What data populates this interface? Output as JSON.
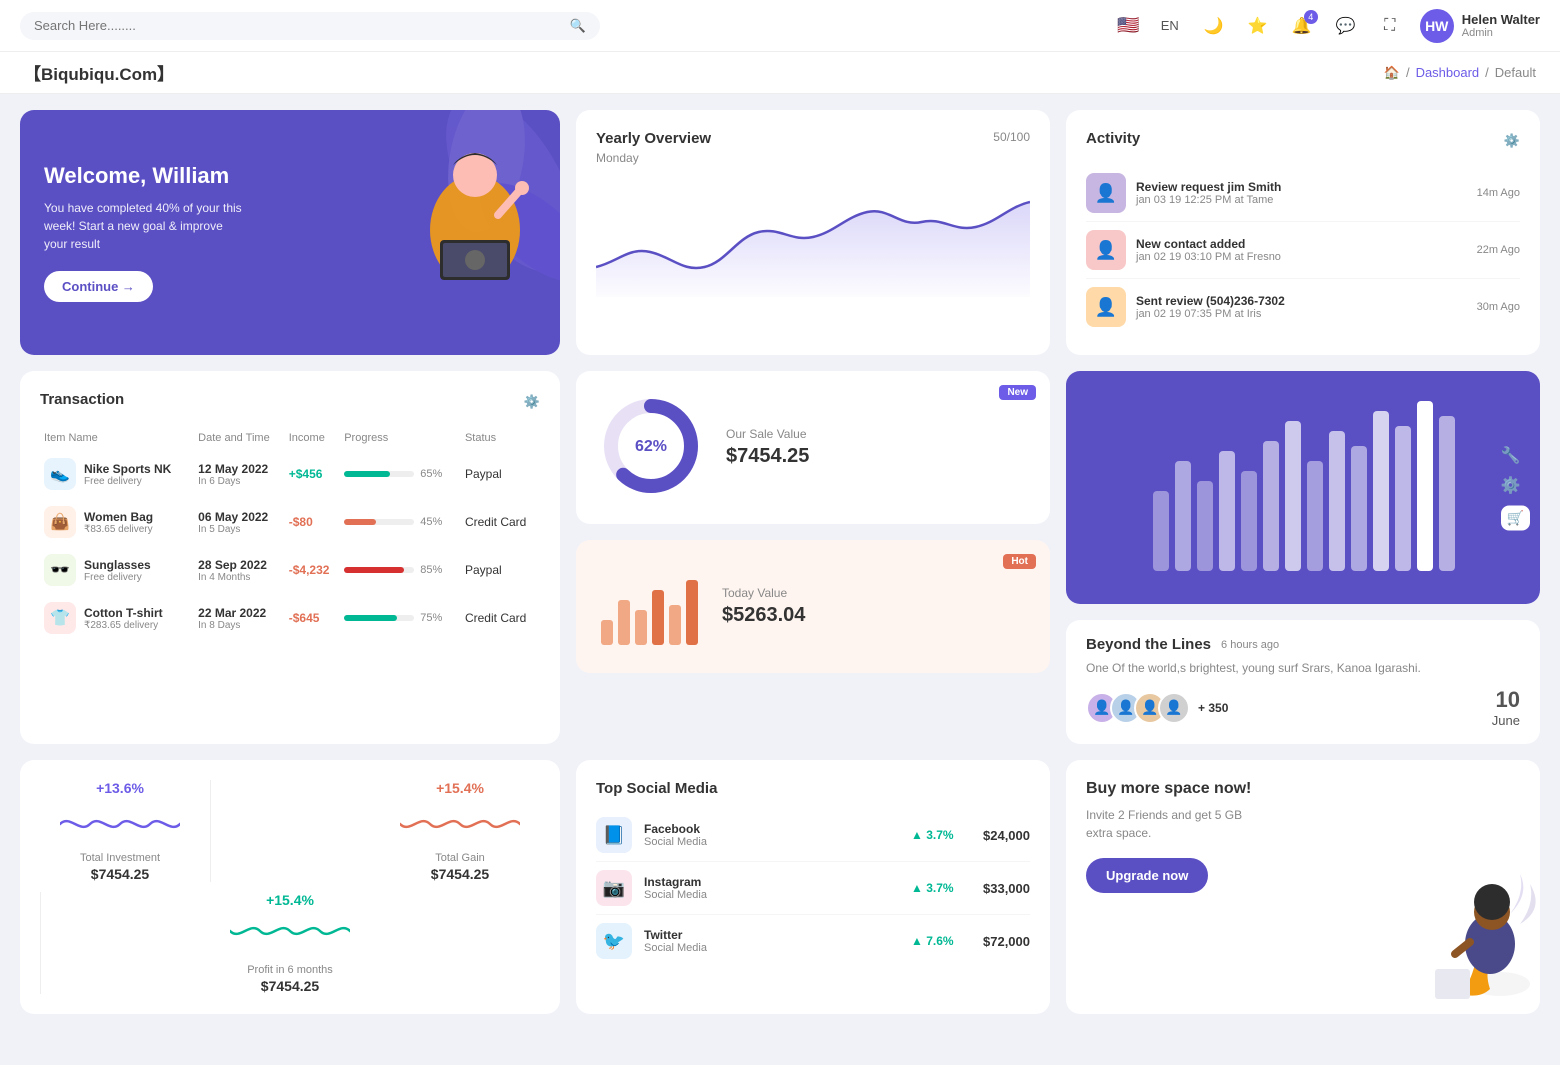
{
  "topnav": {
    "search_placeholder": "Search Here........",
    "language": "EN",
    "notification_count": "4",
    "user": {
      "name": "Helen Walter",
      "role": "Admin",
      "initials": "HW"
    }
  },
  "breadcrumb": {
    "brand": "【Biqubiqu.Com】",
    "home": "🏠",
    "path": [
      "Dashboard",
      "Default"
    ]
  },
  "welcome": {
    "title": "Welcome, William",
    "subtitle": "You have completed 40% of your this week! Start a new goal & improve your result",
    "button": "Continue →"
  },
  "yearly": {
    "title": "Yearly Overview",
    "subtitle": "Monday",
    "badge": "50/100"
  },
  "activity": {
    "title": "Activity",
    "items": [
      {
        "title": "Review request jim Smith",
        "time": "jan 03 19 12:25 PM at Tame",
        "ago": "14m Ago",
        "color": "#c8b6e2"
      },
      {
        "title": "New contact added",
        "time": "jan 02 19 03:10 PM at Fresno",
        "ago": "22m Ago",
        "color": "#f8c8c8"
      },
      {
        "title": "Sent review (504)236-7302",
        "time": "jan 02 19 07:35 PM at Iris",
        "ago": "30m Ago",
        "color": "#ffd9a8"
      }
    ]
  },
  "transaction": {
    "title": "Transaction",
    "columns": [
      "Item Name",
      "Date and Time",
      "Income",
      "Progress",
      "Status"
    ],
    "items": [
      {
        "name": "Nike Sports NK",
        "sub": "Free delivery",
        "date": "12 May 2022",
        "period": "In 6 Days",
        "income": "+$456",
        "income_type": "pos",
        "progress": 65,
        "progress_color": "#00b894",
        "status": "Paypal",
        "icon": "👟",
        "icon_bg": "#e8f4fd"
      },
      {
        "name": "Women Bag",
        "sub": "₹83.65 delivery",
        "date": "06 May 2022",
        "period": "In 5 Days",
        "income": "-$80",
        "income_type": "neg",
        "progress": 45,
        "progress_color": "#e17055",
        "status": "Credit Card",
        "icon": "👜",
        "icon_bg": "#fff0e8"
      },
      {
        "name": "Sunglasses",
        "sub": "Free delivery",
        "date": "28 Sep 2022",
        "period": "In 4 Months",
        "income": "-$4,232",
        "income_type": "neg",
        "progress": 85,
        "progress_color": "#d63031",
        "status": "Paypal",
        "icon": "🕶️",
        "icon_bg": "#f0f8e8"
      },
      {
        "name": "Cotton T-shirt",
        "sub": "₹283.65 delivery",
        "date": "22 Mar 2022",
        "period": "In 8 Days",
        "income": "-$645",
        "income_type": "neg",
        "progress": 75,
        "progress_color": "#00b894",
        "status": "Credit Card",
        "icon": "👕",
        "icon_bg": "#ffe8e8"
      }
    ]
  },
  "sale_value": {
    "label": "Our Sale Value",
    "amount": "$7454.25",
    "percent": 62,
    "badge": "New"
  },
  "today_value": {
    "label": "Today Value",
    "amount": "$5263.04",
    "badge": "Hot"
  },
  "beyond": {
    "title": "Beyond the Lines",
    "time_ago": "6 hours ago",
    "description": "One Of the world,s brightest, young surf Srars, Kanoa Igarashi.",
    "plus_count": "+ 350",
    "date_day": "10",
    "date_month": "June"
  },
  "stats_mini": {
    "items": [
      {
        "percent": "+13.6%",
        "percent_color": "#6c5ce7",
        "label": "Total Investment",
        "amount": "$7454.25",
        "wave_color": "#6c5ce7"
      },
      {
        "percent": "+15.4%",
        "percent_color": "#e17055",
        "label": "Total Gain",
        "amount": "$7454.25",
        "wave_color": "#e17055"
      },
      {
        "percent": "+15.4%",
        "percent_color": "#00b894",
        "label": "Profit in 6 months",
        "amount": "$7454.25",
        "wave_color": "#00b894"
      }
    ]
  },
  "social": {
    "title": "Top Social Media",
    "items": [
      {
        "name": "Facebook",
        "type": "Social Media",
        "growth": "3.7%",
        "amount": "$24,000",
        "icon": "📘",
        "icon_bg": "#e8f0fe",
        "icon_color": "#1877f2"
      },
      {
        "name": "Instagram",
        "type": "Social Media",
        "growth": "3.7%",
        "amount": "$33,000",
        "icon": "📷",
        "icon_bg": "#fce4ec",
        "icon_color": "#e1306c"
      },
      {
        "name": "Twitter",
        "type": "Social Media",
        "growth": "7.6%",
        "amount": "$72,000",
        "icon": "🐦",
        "icon_bg": "#e3f2fd",
        "icon_color": "#1da1f2"
      }
    ]
  },
  "upgrade": {
    "title": "Buy more space now!",
    "description": "Invite 2 Friends and get 5 GB extra space.",
    "button": "Upgrade now"
  }
}
